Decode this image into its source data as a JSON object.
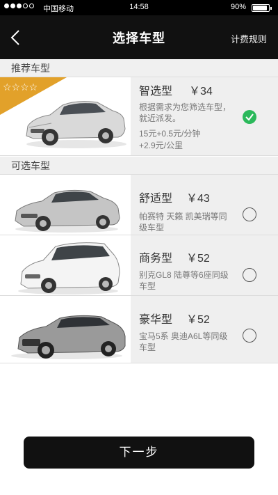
{
  "status_bar": {
    "carrier": "中国移动",
    "time": "14:58",
    "battery": "90%",
    "battery_level": 0.9,
    "signal_bars_filled": 3,
    "signal_bars_total": 5
  },
  "nav": {
    "title": "选择车型",
    "right_link": "计费规则",
    "back_icon": "chevron-left-icon"
  },
  "sections": {
    "recommended": "推荐车型",
    "optional": "可选车型"
  },
  "recommended_car": {
    "name": "智选型",
    "price": "￥34",
    "desc": "根据需求为您筛选车型，就近派发。",
    "fee_line1": "15元+0.5元/分钟",
    "fee_line2": "+2.9元/公里",
    "selected": true,
    "ribbon_stars": "☆☆☆☆"
  },
  "cars": [
    {
      "name": "舒适型",
      "price": "￥43",
      "desc": "帕赛特 天籁 凯美瑞等同级车型",
      "selected": false
    },
    {
      "name": "商务型",
      "price": "￥52",
      "desc": "别克GL8 陆尊等6座同级车型",
      "selected": false
    },
    {
      "name": "豪华型",
      "price": "￥52",
      "desc": "宝马5系 奥迪A6L等同级车型",
      "selected": false
    }
  ],
  "next_button": "下一步",
  "colors": {
    "nav_bg": "#111111",
    "check_green": "#2bb95b",
    "ribbon_gold": "#e2a12a",
    "info_bg": "#efefef"
  }
}
